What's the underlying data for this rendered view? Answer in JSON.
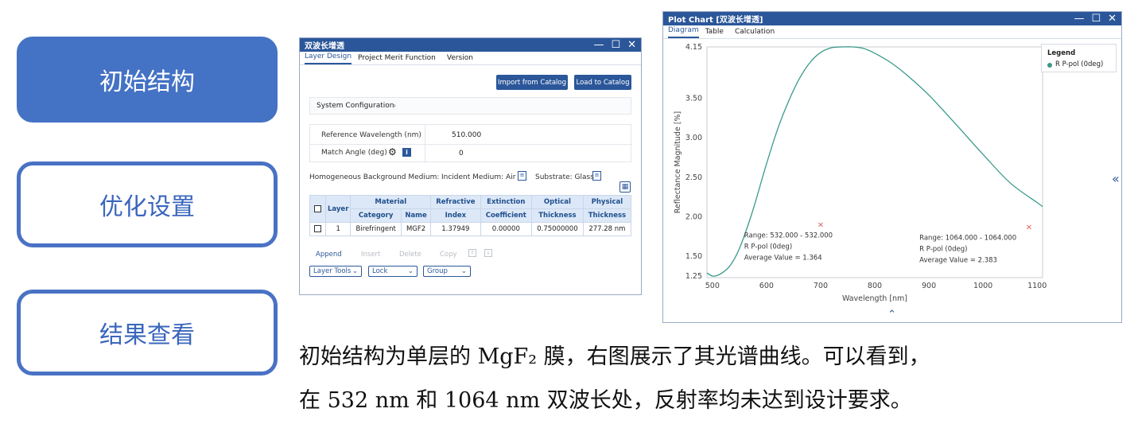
{
  "steps": [
    {
      "label": "初始结构",
      "active": true
    },
    {
      "label": "优化设置",
      "active": false
    },
    {
      "label": "结果查看",
      "active": false
    }
  ],
  "design_window": {
    "title": "双波长增透",
    "controls": [
      "—",
      "☐",
      "✕"
    ],
    "tabs": [
      "Layer Design",
      "Project Merit Function",
      "Version"
    ],
    "import_button": "Import from Catalog",
    "load_button": "Load to Catalog",
    "system_config": "System Configuration",
    "ref_wavelength_label": "Reference Wavelength (nm)",
    "ref_wavelength_value": "510.000",
    "match_angle_label": "Match Angle (deg)",
    "match_angle_value": "0",
    "background_label": "Homogeneous Background Medium:",
    "incident_label": "Incident Medium: Air",
    "substrate_label": "Substrate: Glass",
    "table": {
      "headers": {
        "layer": "Layer",
        "material": "Material",
        "category": "Category",
        "name": "Name",
        "refractive": "Refractive",
        "index": "Index",
        "extinction": "Extinction",
        "coefficient": "Coefficient",
        "optical": "Optical",
        "optical_thk": "Thickness",
        "physical": "Physical",
        "physical_thk": "Thickness"
      },
      "rows": [
        {
          "layer": "1",
          "category": "Birefringent",
          "name": "MGF2",
          "index": "1.37949",
          "extinction": "0.00000",
          "optical": "0.75000000",
          "physical": "277.28 nm"
        }
      ]
    },
    "actions": [
      "Append",
      "Insert",
      "Delete",
      "Copy"
    ],
    "layer_tools": "Layer Tools",
    "lock": "Lock",
    "group": "Group"
  },
  "plot_window": {
    "title": "Plot Chart [双波长增透]",
    "controls": [
      "—",
      "☐",
      "✕"
    ],
    "tabs": [
      "Diagram",
      "Table",
      "Calculation"
    ],
    "legend_title": "Legend",
    "expand_icon": "double-chevron-left",
    "collapse_icon": "double-chevron-up"
  },
  "chart_data": {
    "type": "line",
    "xlabel": "Wavelength [nm]",
    "ylabel": "Reflectance Magnitude [%]",
    "xlim": [
      490,
      1110
    ],
    "ylim": [
      1.23,
      4.15
    ],
    "xticks": [
      500,
      600,
      700,
      800,
      900,
      1000,
      1100
    ],
    "yticks": [
      1.25,
      1.5,
      2.0,
      2.5,
      3.0,
      3.5,
      4.15
    ],
    "ytick_labels": [
      "1.25",
      "1.50",
      "2.00",
      "2.50",
      "3.00",
      "3.50",
      "4.15"
    ],
    "legend_position": "top-right",
    "grid": false,
    "series": [
      {
        "name": "R P-pol (0deg)",
        "color": "#3a9a8a",
        "x": [
          490,
          500,
          510,
          520,
          530,
          540,
          550,
          560,
          570,
          580,
          600,
          620,
          640,
          660,
          680,
          700,
          720,
          740,
          760,
          780,
          800,
          830,
          860,
          900,
          950,
          1000,
          1050,
          1100,
          1110
        ],
        "y": [
          1.29,
          1.25,
          1.26,
          1.3,
          1.36,
          1.46,
          1.6,
          1.78,
          1.98,
          2.2,
          2.67,
          3.1,
          3.45,
          3.74,
          3.95,
          4.08,
          4.14,
          4.15,
          4.15,
          4.13,
          4.07,
          3.95,
          3.79,
          3.54,
          3.17,
          2.79,
          2.43,
          2.18,
          2.13
        ]
      }
    ],
    "annotations": [
      {
        "x": 700,
        "y": 1.87,
        "marker": "x",
        "color": "#e05050",
        "lines": [
          "Range: 532.000 - 532.000",
          "R P-pol (0deg)",
          "Average Value = 1.364"
        ]
      },
      {
        "x": 1085,
        "y": 1.84,
        "marker": "x",
        "color": "#e05050",
        "lines": [
          "Range: 1064.000 - 1064.000",
          "R P-pol (0deg)",
          "Average Value = 2.383"
        ]
      }
    ]
  },
  "caption": {
    "line1": "初始结构为单层的 MgF₂ 膜，右图展示了其光谱曲线。可以看到，",
    "line2": "在 532 nm 和 1064 nm 双波长处，反射率均未达到设计要求。"
  }
}
